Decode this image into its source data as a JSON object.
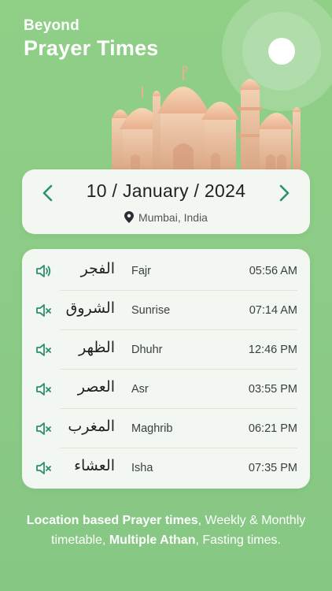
{
  "header": {
    "kicker": "Beyond",
    "title": "Prayer Times"
  },
  "date_nav": {
    "date": "10 / January / 2024",
    "location": "Mumbai, India"
  },
  "prayers": [
    {
      "arabic": "الفجر",
      "name": "Fajr",
      "time": "05:56 AM",
      "sound": "on"
    },
    {
      "arabic": "الشروق",
      "name": "Sunrise",
      "time": "07:14 AM",
      "sound": "off"
    },
    {
      "arabic": "الظهر",
      "name": "Dhuhr",
      "time": "12:46 PM",
      "sound": "off"
    },
    {
      "arabic": "العصر",
      "name": "Asr",
      "time": "03:55 PM",
      "sound": "off"
    },
    {
      "arabic": "المغرب",
      "name": "Maghrib",
      "time": "06:21 PM",
      "sound": "off"
    },
    {
      "arabic": "العشاء",
      "name": "Isha",
      "time": "07:35 PM",
      "sound": "off"
    }
  ],
  "footer": {
    "part1_bold": "Location based Prayer times",
    "part2": ", Weekly & Monthly timetable, ",
    "part3_bold": "Multiple Athan",
    "part4": ", Fasting times."
  },
  "colors": {
    "accent": "#2f8f6d",
    "background": "#8ccc86",
    "card": "#f3f7f1"
  },
  "icons": {
    "prev": "chevron-left-icon",
    "next": "chevron-right-icon",
    "location": "location-pin-icon",
    "sound_on": "speaker-on-icon",
    "sound_off": "speaker-muted-icon"
  }
}
